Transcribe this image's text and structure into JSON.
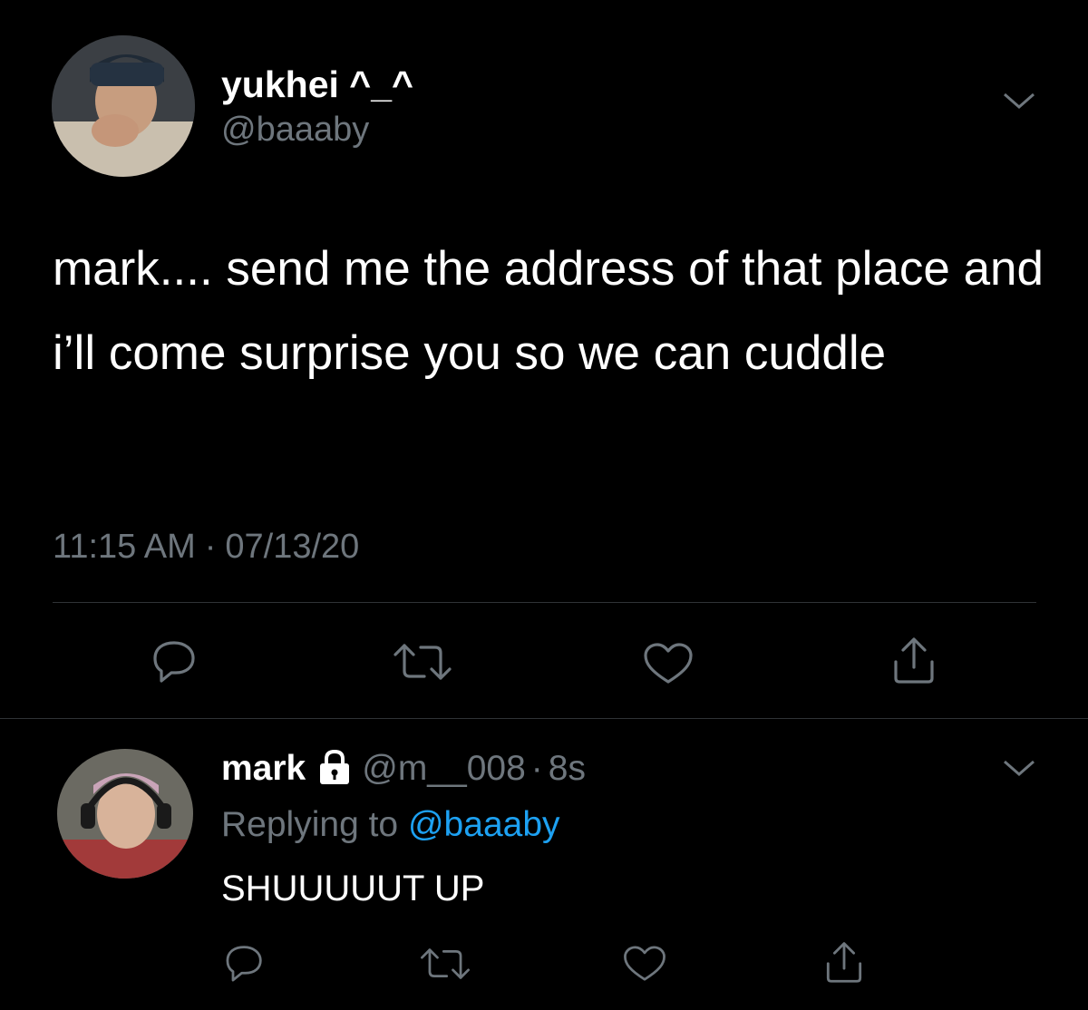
{
  "main_tweet": {
    "display_name": "yukhei ^_^",
    "handle": "@baaaby",
    "text": "mark.... send me the address of that place and i’ll come surprise you so we can cuddle",
    "time": "11:15 AM",
    "separator": "·",
    "date": "07/13/20",
    "actions": [
      "reply-icon",
      "retweet-icon",
      "like-icon",
      "share-icon"
    ]
  },
  "reply_tweet": {
    "display_name": "mark",
    "protected_icon": "lock-icon",
    "handle": "@m__008",
    "separator": "·",
    "time": "8s",
    "replying_label": "Replying to",
    "replying_handle": "@baaaby",
    "text": "SHUUUUUT UP",
    "actions": [
      "reply-icon",
      "retweet-icon",
      "like-icon",
      "share-icon"
    ]
  },
  "colors": {
    "background": "#000000",
    "text_primary": "#ffffff",
    "text_secondary": "#6e767d",
    "link": "#1da1f2",
    "divider": "#2f3336"
  }
}
